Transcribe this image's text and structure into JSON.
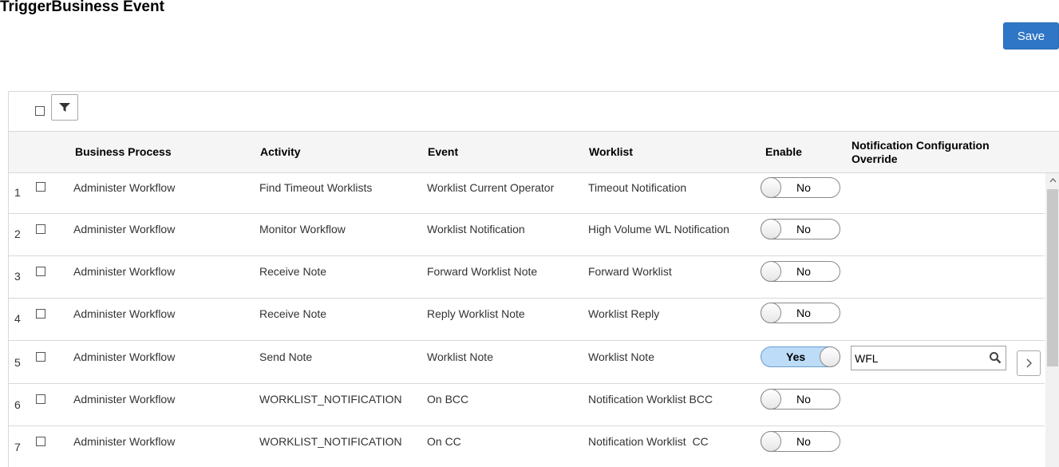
{
  "page": {
    "title": "TriggerBusiness Event"
  },
  "toolbar": {
    "save_label": "Save"
  },
  "grid": {
    "columns": {
      "business_process": "Business Process",
      "activity": "Activity",
      "event": "Event",
      "worklist": "Worklist",
      "enable": "Enable",
      "notification_line1": "Notification Configuration",
      "notification_line2": "Override"
    },
    "rows": [
      {
        "num": "1",
        "business_process": "Administer Workflow",
        "activity": "Find Timeout Worklists",
        "event": "Worklist Current Operator",
        "worklist": "Timeout Notification",
        "enable": "No"
      },
      {
        "num": "2",
        "business_process": "Administer Workflow",
        "activity": "Monitor Workflow",
        "event": "Worklist Notification",
        "worklist": "High Volume WL Notification",
        "enable": "No"
      },
      {
        "num": "3",
        "business_process": "Administer Workflow",
        "activity": "Receive Note",
        "event": "Forward Worklist Note",
        "worklist": "Forward Worklist",
        "enable": "No"
      },
      {
        "num": "4",
        "business_process": "Administer Workflow",
        "activity": "Receive Note",
        "event": "Reply Worklist Note",
        "worklist": "Worklist Reply",
        "enable": "No"
      },
      {
        "num": "5",
        "business_process": "Administer Workflow",
        "activity": "Send Note",
        "event": "Worklist Note",
        "worklist": "Worklist Note",
        "enable": "Yes",
        "notification_override": "WFL"
      },
      {
        "num": "6",
        "business_process": "Administer Workflow",
        "activity": "WORKLIST_NOTIFICATION",
        "event": "On BCC",
        "worklist": "Notification Worklist BCC",
        "enable": "No"
      },
      {
        "num": "7",
        "business_process": "Administer Workflow",
        "activity": "WORKLIST_NOTIFICATION",
        "event": "On CC",
        "worklist": "Notification Worklist  CC",
        "enable": "No"
      }
    ]
  },
  "icons": {
    "filter": "filter-icon",
    "lookup": "search-icon",
    "detail": "chevron-right-icon",
    "scroll_up": "chevron-up-icon"
  },
  "colors": {
    "accent": "#2f77c6",
    "toggle_on": "#bcdcf8"
  }
}
